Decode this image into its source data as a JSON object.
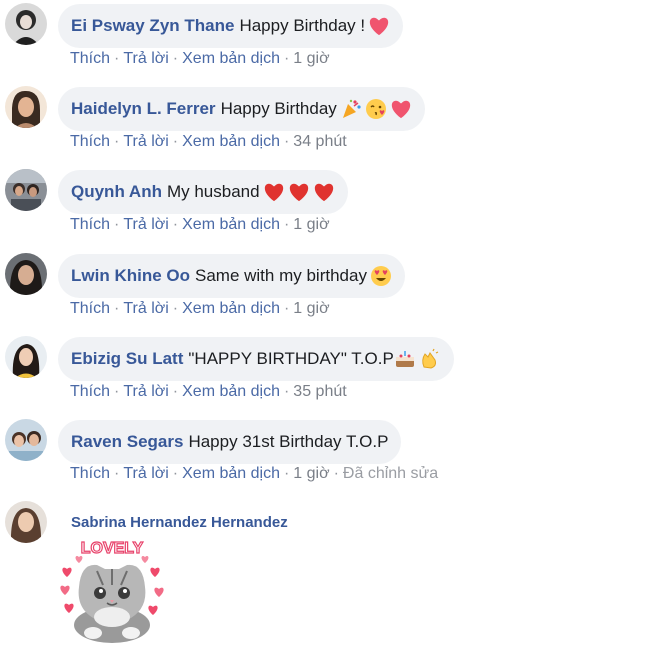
{
  "actions": {
    "like": "Thích",
    "reply": "Trả lời",
    "translate": "Xem bản dịch"
  },
  "comments": [
    {
      "author": "Ei Psway Zyn Thane",
      "text": "Happy Birthday !",
      "time": "1 giờ",
      "emoji": [
        "heart-icon"
      ]
    },
    {
      "author": "Haidelyn L. Ferrer",
      "text": "Happy Birthday",
      "time": "34 phút",
      "emoji": [
        "party-popper-icon",
        "face-blowing-kiss-icon",
        "heart-icon"
      ]
    },
    {
      "author": "Quynh Anh",
      "text": "My husband",
      "time": "1 giờ",
      "emoji": [
        "heart-icon",
        "heart-icon",
        "heart-icon"
      ]
    },
    {
      "author": "Lwin Khine Oo",
      "text": "Same with my birthday",
      "time": "1 giờ",
      "emoji": [
        "heart-eyes-face-icon"
      ]
    },
    {
      "author": "Ebizig Su Latt",
      "text": "\"HAPPY BIRTHDAY\" T.O.P",
      "time": "35 phút",
      "emoji": [
        "birthday-cake-icon",
        "clapping-hands-icon"
      ]
    },
    {
      "author": "Raven Segars",
      "text": "Happy 31st Birthday T.O.P",
      "time": "1 giờ",
      "edited": "Đã chỉnh sửa",
      "emoji": []
    },
    {
      "author": "Sabrina Hernandez Hernandez",
      "sticker": "lovely-cat-sticker",
      "sticker_text": "LOVELY"
    }
  ],
  "colors": {
    "author": "#385898",
    "bubble": "#f0f2f5",
    "heart": "#e4425e"
  }
}
